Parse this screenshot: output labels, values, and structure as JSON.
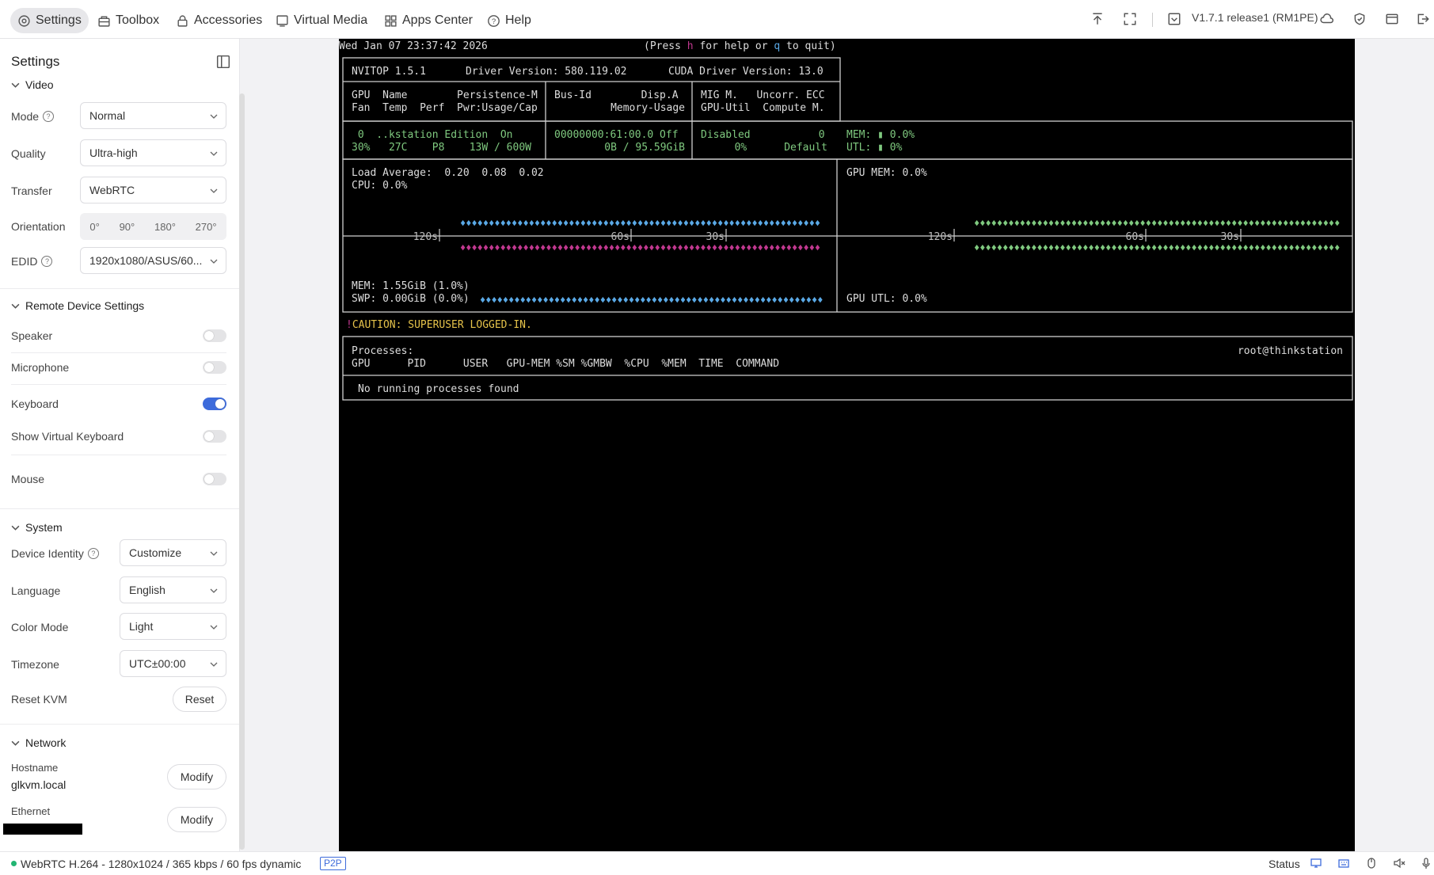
{
  "topbar": {
    "tabs": [
      {
        "label": "Settings",
        "icon": "gear-icon"
      },
      {
        "label": "Toolbox",
        "icon": "toolbox-icon"
      },
      {
        "label": "Accessories",
        "icon": "lock-icon"
      },
      {
        "label": "Virtual Media",
        "icon": "monitor-icon"
      },
      {
        "label": "Apps Center",
        "icon": "apps-icon"
      },
      {
        "label": "Help",
        "icon": "help-icon"
      }
    ],
    "version": "V1.7.1 release1 (RM1PE)"
  },
  "sidebar": {
    "title": "Settings",
    "video": {
      "heading": "Video",
      "mode_label": "Mode",
      "mode_value": "Normal",
      "quality_label": "Quality",
      "quality_value": "Ultra-high",
      "transfer_label": "Transfer",
      "transfer_value": "WebRTC",
      "orientation_label": "Orientation",
      "orientation_options": [
        "0°",
        "90°",
        "180°",
        "270°"
      ],
      "edid_label": "EDID",
      "edid_value": "1920x1080/ASUS/60..."
    },
    "remote": {
      "heading": "Remote Device Settings",
      "speaker_label": "Speaker",
      "speaker_on": false,
      "microphone_label": "Microphone",
      "microphone_on": false,
      "keyboard_label": "Keyboard",
      "keyboard_on": true,
      "virtual_keyboard_label": "Show Virtual Keyboard",
      "virtual_keyboard_on": false,
      "mouse_label": "Mouse",
      "mouse_on": false
    },
    "system": {
      "heading": "System",
      "device_identity_label": "Device Identity",
      "device_identity_value": "Customize",
      "language_label": "Language",
      "language_value": "English",
      "color_mode_label": "Color Mode",
      "color_mode_value": "Light",
      "timezone_label": "Timezone",
      "timezone_value": "UTC±00:00",
      "reset_label": "Reset KVM",
      "reset_button": "Reset"
    },
    "network": {
      "heading": "Network",
      "hostname_label": "Hostname",
      "hostname_value": "glkvm.local",
      "modify_button": "Modify",
      "ethernet_label": "Ethernet"
    }
  },
  "terminal": {
    "header_time": "Wed Jan 07 23:37:42 2026",
    "help_prefix": "(Press ",
    "help_h": "h",
    "help_mid": " for help or ",
    "help_q": "q",
    "help_suffix": " to quit)",
    "nvitop": "NVITOP 1.5.1",
    "driver": "Driver Version: 580.119.02",
    "cuda": "CUDA Driver Version: 13.0",
    "col_a1": "GPU  Name        Persistence-M",
    "col_a2": "Fan  Temp  Perf  Pwr:Usage/Cap",
    "col_b1": "Bus-Id        Disp.A",
    "col_b2": "Memory-Usage",
    "col_c1": "MIG M.   Uncorr. ECC",
    "col_c2": "GPU-Util  Compute M.",
    "gpu_a1": " 0  ..kstation Edition  On",
    "gpu_a2": "30%   27C    P8    13W / 600W",
    "gpu_b1": "00000000:61:00.0 Off",
    "gpu_b2": "0B / 95.59GiB",
    "gpu_c1": "Disabled           0",
    "gpu_c2": "0%      Default",
    "gpu_mem_pct": "MEM: ▮ 0.0%",
    "gpu_utl_pct": "UTL: ▮ 0%",
    "load_avg": "Load Average:  0.20  0.08  0.02",
    "cpu": "CPU: 0.0%",
    "mem": "MEM: 1.55GiB (1.0%)",
    "swp": "SWP: 0.00GiB (0.0%)",
    "gpu_mem": "GPU MEM: 0.0%",
    "gpu_utl": "GPU UTL: 0.0%",
    "tick_120": "120s",
    "tick_60": "60s",
    "tick_30": "30s",
    "caution_mark": "!",
    "caution": "CAUTION: SUPERUSER LOGGED-IN.",
    "processes": "Processes:",
    "user_host": "root@thinkstation",
    "proc_headers": "GPU      PID      USER   GPU-MEM %SM %GMBW  %CPU  %MEM  TIME  COMMAND",
    "no_proc": "No running processes found",
    "colors": {
      "blue": "#5aa9e6",
      "magenta": "#c0388f",
      "green": "#7fc97f",
      "yellow": "#e6c34a"
    }
  },
  "statusbar": {
    "stream": "WebRTC H.264 - 1280x1024 / 365 kbps / 60 fps dynamic",
    "p2p": "P2P",
    "status": "Status"
  }
}
